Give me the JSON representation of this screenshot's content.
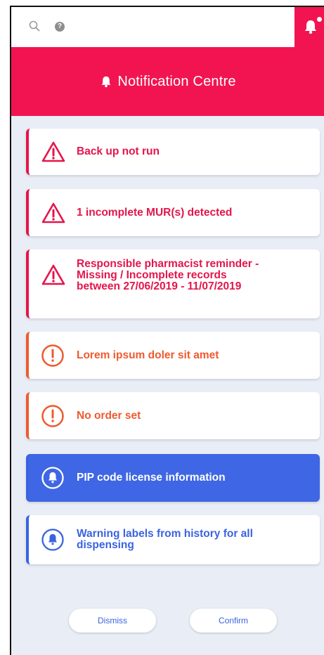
{
  "topbar": {
    "help_glyph": "?"
  },
  "header": {
    "title": "Notification Centre"
  },
  "notifications": [
    {
      "text": "Back up not run",
      "severity": "error"
    },
    {
      "text": "1 incomplete MUR(s) detected",
      "severity": "error"
    },
    {
      "text": "Responsible pharmacist reminder - Missing / Incomplete records between 27/06/2019 - 11/07/2019",
      "severity": "error"
    },
    {
      "text": "Lorem ipsum doler sit amet",
      "severity": "warning"
    },
    {
      "text": "No order set",
      "severity": "warning"
    },
    {
      "text": "PIP code license information",
      "severity": "info-selected"
    },
    {
      "text": "Warning labels from history for all dispensing",
      "severity": "info"
    }
  ],
  "actions": {
    "dismiss": "Dismiss",
    "confirm": "Confirm"
  },
  "colors": {
    "accent": "#f21451",
    "error": "#e4154b",
    "warning": "#ee5a2f",
    "info": "#3a63e0",
    "background": "#e9edf6"
  },
  "icons": [
    "search-icon",
    "help-icon",
    "bell-icon",
    "warning-triangle-icon",
    "exclamation-circle-icon",
    "bell-circle-icon"
  ]
}
